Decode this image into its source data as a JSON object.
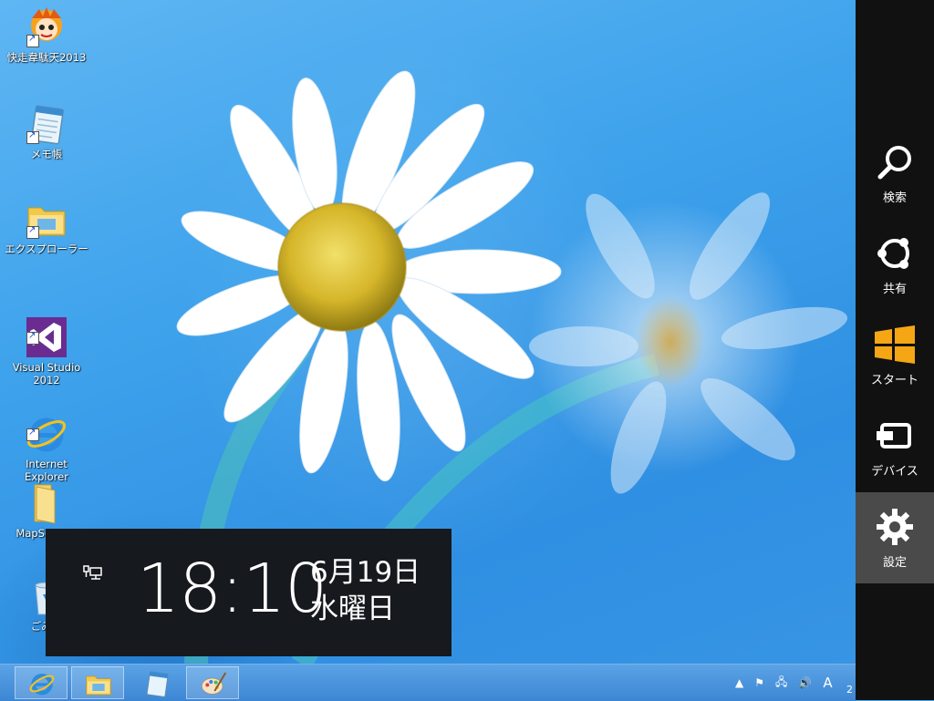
{
  "desktop_icons": [
    {
      "label": "快走韋駄天2013"
    },
    {
      "label": "メモ帳"
    },
    {
      "label": "エクスプローラー"
    },
    {
      "label": "Visual Studio\n2012"
    },
    {
      "label": "Internet\nExplorer"
    },
    {
      "label": "MapSea…"
    },
    {
      "label": "ごみ…"
    }
  ],
  "clock_overlay": {
    "time": "18:10",
    "date": "6月19日",
    "weekday": "水曜日"
  },
  "charms": [
    {
      "label": "検索",
      "icon": "search-icon"
    },
    {
      "label": "共有",
      "icon": "share-icon"
    },
    {
      "label": "スタート",
      "icon": "windows-logo-icon"
    },
    {
      "label": "デバイス",
      "icon": "devices-icon"
    },
    {
      "label": "設定",
      "icon": "gear-icon",
      "active": true
    }
  ],
  "taskbar": {
    "pinned": [
      {
        "icon": "internet-explorer-icon"
      },
      {
        "icon": "file-explorer-icon"
      },
      {
        "icon": "notepad-icon"
      },
      {
        "icon": "paint-icon"
      }
    ],
    "tray": {
      "ime_mode": "A",
      "clock_partial": "2"
    }
  },
  "colors": {
    "charms_bg": "#111111",
    "charm_active": "#4a4a4a",
    "start_orange": "#f4a614",
    "clock_bg": "#16191d"
  }
}
